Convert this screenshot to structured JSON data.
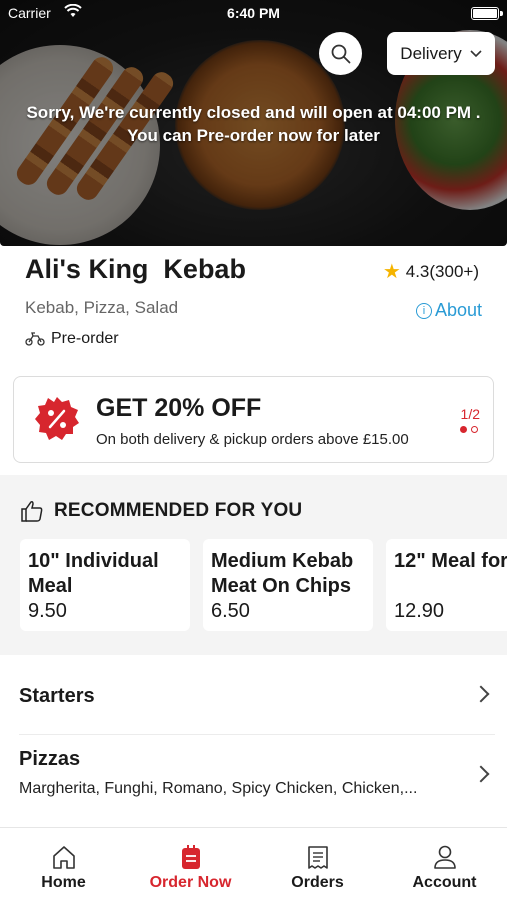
{
  "status_bar": {
    "carrier": "Carrier",
    "time": "6:40 PM"
  },
  "hero": {
    "search_icon": "search-icon",
    "delivery_label": "Delivery",
    "closed_message_line1": "Sorry, We're currently closed and will open at 04:00 PM .",
    "closed_message_line2": "You can Pre-order now for later"
  },
  "restaurant": {
    "name": "Ali's King  Kebab",
    "rating": "4.3(300+)",
    "cuisines": "Kebab, Pizza, Salad",
    "about_label": "About",
    "order_mode": "Pre-order"
  },
  "offer": {
    "title": "GET 20% OFF",
    "subtitle": "On both delivery & pickup orders above £15.00",
    "page_indicator": "1/2",
    "accent_color": "#d7262e"
  },
  "recommended": {
    "heading": "RECOMMENDED FOR YOU",
    "items": [
      {
        "name": "10\" Individual Meal",
        "price": "9.50"
      },
      {
        "name": "Medium Kebab Meat On Chips",
        "price": "6.50"
      },
      {
        "name": "12\" Meal for",
        "price": "12.90"
      }
    ]
  },
  "menu": {
    "categories": [
      {
        "title": "Starters",
        "description": ""
      },
      {
        "title": "Pizzas",
        "description": "Margherita, Funghi, Romano, Spicy Chicken, Chicken,..."
      }
    ]
  },
  "tabbar": {
    "tabs": [
      {
        "label": "Home",
        "icon": "home-icon"
      },
      {
        "label": "Order Now",
        "icon": "order-icon"
      },
      {
        "label": "Orders",
        "icon": "receipt-icon"
      },
      {
        "label": "Account",
        "icon": "person-icon"
      }
    ],
    "active_index": 1
  }
}
